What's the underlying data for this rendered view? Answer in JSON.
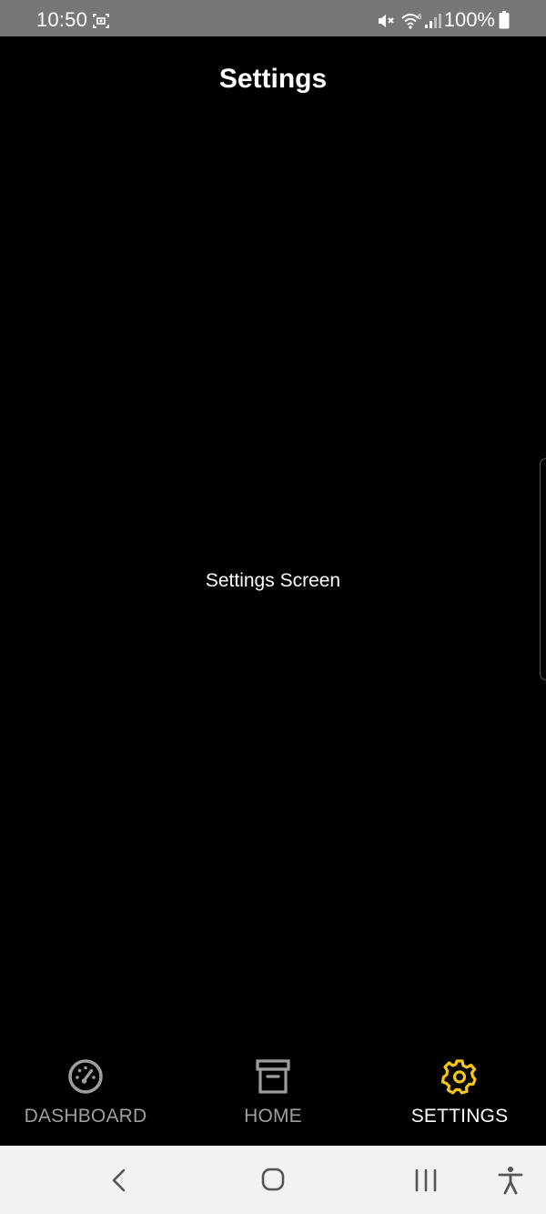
{
  "status_bar": {
    "time": "10:50",
    "battery_percent": "100%",
    "background_color": "#777777"
  },
  "header": {
    "title": "Settings"
  },
  "content": {
    "text": "Settings Screen"
  },
  "bottom_nav": {
    "items": [
      {
        "label": "DASHBOARD",
        "icon": "speedometer-icon",
        "active": false
      },
      {
        "label": "HOME",
        "icon": "archive-box-icon",
        "active": false
      },
      {
        "label": "SETTINGS",
        "icon": "gear-icon",
        "active": true
      }
    ],
    "active_color": "#F5C518",
    "inactive_color": "#9E9E9E"
  },
  "system_nav": {
    "buttons": [
      "back-icon",
      "home-circle-icon",
      "recents-icon",
      "accessibility-icon"
    ],
    "background_color": "#F2F1F3"
  }
}
